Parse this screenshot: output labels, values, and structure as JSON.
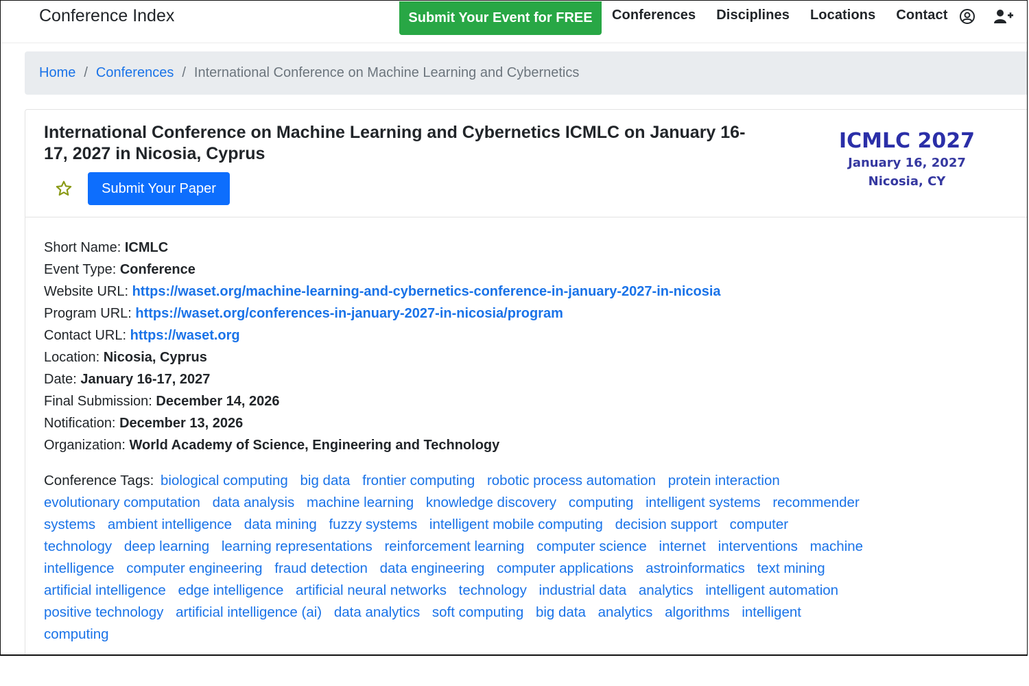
{
  "nav": {
    "brand": "Conference Index",
    "submit_event": "Submit Your Event for FREE",
    "links": [
      "Conferences",
      "Disciplines",
      "Locations",
      "Contact"
    ],
    "icons": [
      "user-circle-icon",
      "user-plus-icon"
    ]
  },
  "breadcrumb": {
    "home": "Home",
    "conferences": "Conferences",
    "current": "International Conference on Machine Learning and Cybernetics"
  },
  "event": {
    "title": "International Conference on Machine Learning and Cybernetics ICMLC on January 16-17, 2027 in Nicosia, Cyprus",
    "submit_paper": "Submit Your Paper",
    "logo": {
      "title": "ICMLC 2027",
      "date": "January 16, 2027",
      "place": "Nicosia, CY"
    },
    "details": {
      "short_name_label": "Short Name:",
      "short_name": "ICMLC",
      "event_type_label": "Event Type:",
      "event_type": "Conference",
      "website_label": "Website URL:",
      "website": "https://waset.org/machine-learning-and-cybernetics-conference-in-january-2027-in-nicosia",
      "program_label": "Program URL:",
      "program": "https://waset.org/conferences-in-january-2027-in-nicosia/program",
      "contact_label": "Contact URL:",
      "contact": "https://waset.org",
      "location_label": "Location:",
      "location": "Nicosia, Cyprus",
      "date_label": "Date:",
      "date": "January 16-17, 2027",
      "final_submission_label": "Final Submission:",
      "final_submission": "December 14, 2026",
      "notification_label": "Notification:",
      "notification": "December 13, 2026",
      "organization_label": "Organization:",
      "organization": "World Academy of Science, Engineering and Technology"
    },
    "tags_label": "Conference Tags:",
    "tags": [
      "biological computing",
      "big data",
      "frontier computing",
      "robotic process automation",
      "protein interaction",
      "evolutionary computation",
      "data analysis",
      "machine learning",
      "knowledge discovery",
      "computing",
      "intelligent systems",
      "recommender systems",
      "ambient intelligence",
      "data mining",
      "fuzzy systems",
      "intelligent mobile computing",
      "decision support",
      "computer technology",
      "deep learning",
      "learning representations",
      "reinforcement learning",
      "computer science",
      "internet",
      "interventions",
      "machine intelligence",
      "computer engineering",
      "fraud detection",
      "data engineering",
      "computer applications",
      "astroinformatics",
      "text mining",
      "artificial intelligence",
      "edge intelligence",
      "artificial neural networks",
      "technology",
      "industrial data",
      "analytics",
      "intelligent automation",
      "positive technology",
      "artificial intelligence (ai)",
      "data analytics",
      "soft computing",
      "big data",
      "analytics",
      "algorithms",
      "intelligent computing"
    ]
  }
}
